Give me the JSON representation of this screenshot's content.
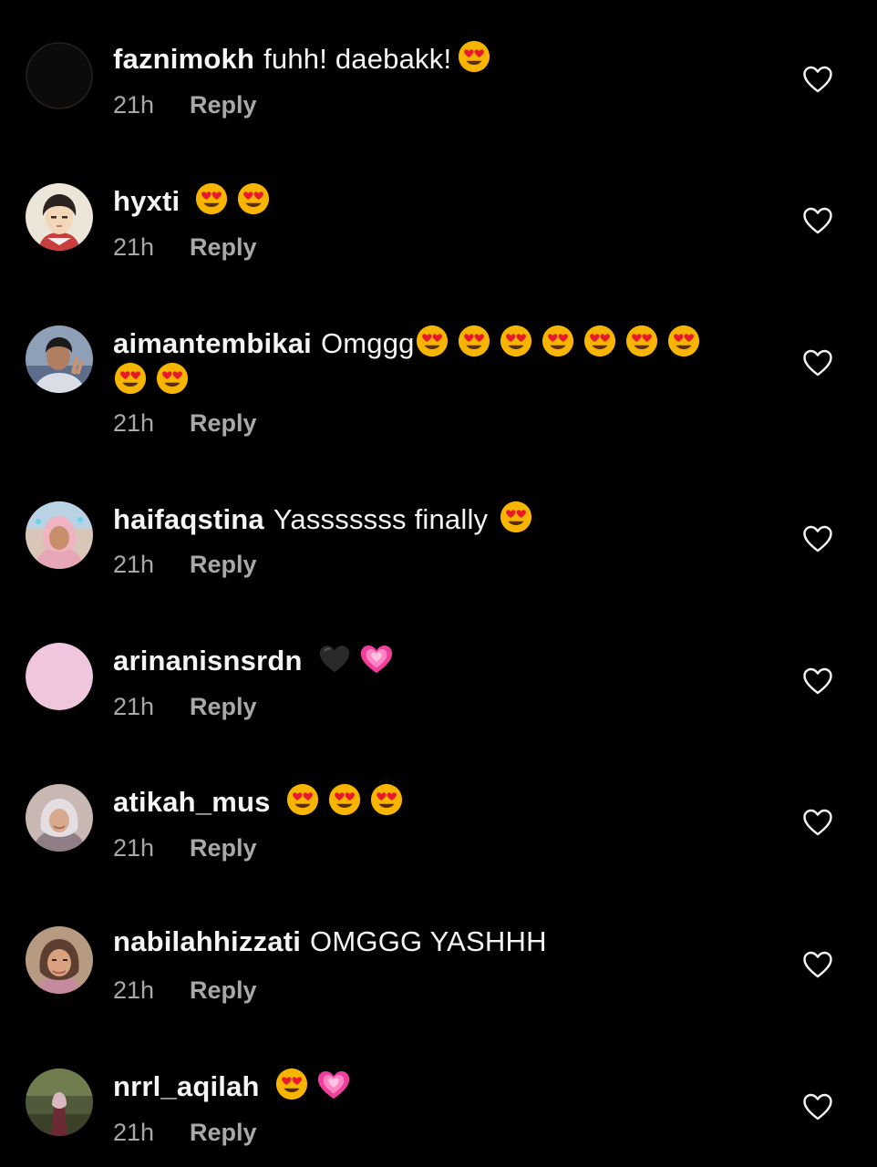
{
  "comments": [
    {
      "username": "faznimokh",
      "text": "fuhh! daebakk!",
      "emojis": [
        "heart-eyes"
      ],
      "time": "21h",
      "reply_label": "Reply",
      "avatar": "dark-circle"
    },
    {
      "username": "hyxti",
      "text": "",
      "emojis": [
        "heart-eyes",
        "heart-eyes"
      ],
      "time": "21h",
      "reply_label": "Reply",
      "avatar": "anime-character"
    },
    {
      "username": "aimantembikai",
      "text": "Omggg",
      "emojis": [
        "heart-eyes",
        "heart-eyes",
        "heart-eyes",
        "heart-eyes",
        "heart-eyes",
        "heart-eyes",
        "heart-eyes",
        "heart-eyes",
        "heart-eyes"
      ],
      "time": "21h",
      "reply_label": "Reply",
      "avatar": "person-peace-sign"
    },
    {
      "username": "haifaqstina",
      "text": "Yasssssss finally",
      "emojis": [
        "heart-eyes"
      ],
      "time": "21h",
      "reply_label": "Reply",
      "avatar": "person-pink-hijab"
    },
    {
      "username": "arinanisnsrdn",
      "text": "",
      "emojis": [
        "black-heart",
        "growing-heart"
      ],
      "time": "21h",
      "reply_label": "Reply",
      "avatar": "pink-circle"
    },
    {
      "username": "atikah_mus",
      "text": "",
      "emojis": [
        "heart-eyes",
        "heart-eyes",
        "heart-eyes"
      ],
      "time": "21h",
      "reply_label": "Reply",
      "avatar": "person-hijab"
    },
    {
      "username": "nabilahhizzati",
      "text": "OMGGG YASHHH",
      "emojis": [],
      "time": "21h",
      "reply_label": "Reply",
      "avatar": "person-selfie"
    },
    {
      "username": "nrrl_aqilah",
      "text": "",
      "emojis": [
        "heart-eyes",
        "growing-heart"
      ],
      "time": "21h",
      "reply_label": "Reply",
      "avatar": "person-outdoor"
    }
  ],
  "like_icon": "heart-outline-icon",
  "colors": {
    "background": "#000000",
    "primary_text": "#f5f5f5",
    "secondary_text": "#a8a8a8"
  }
}
